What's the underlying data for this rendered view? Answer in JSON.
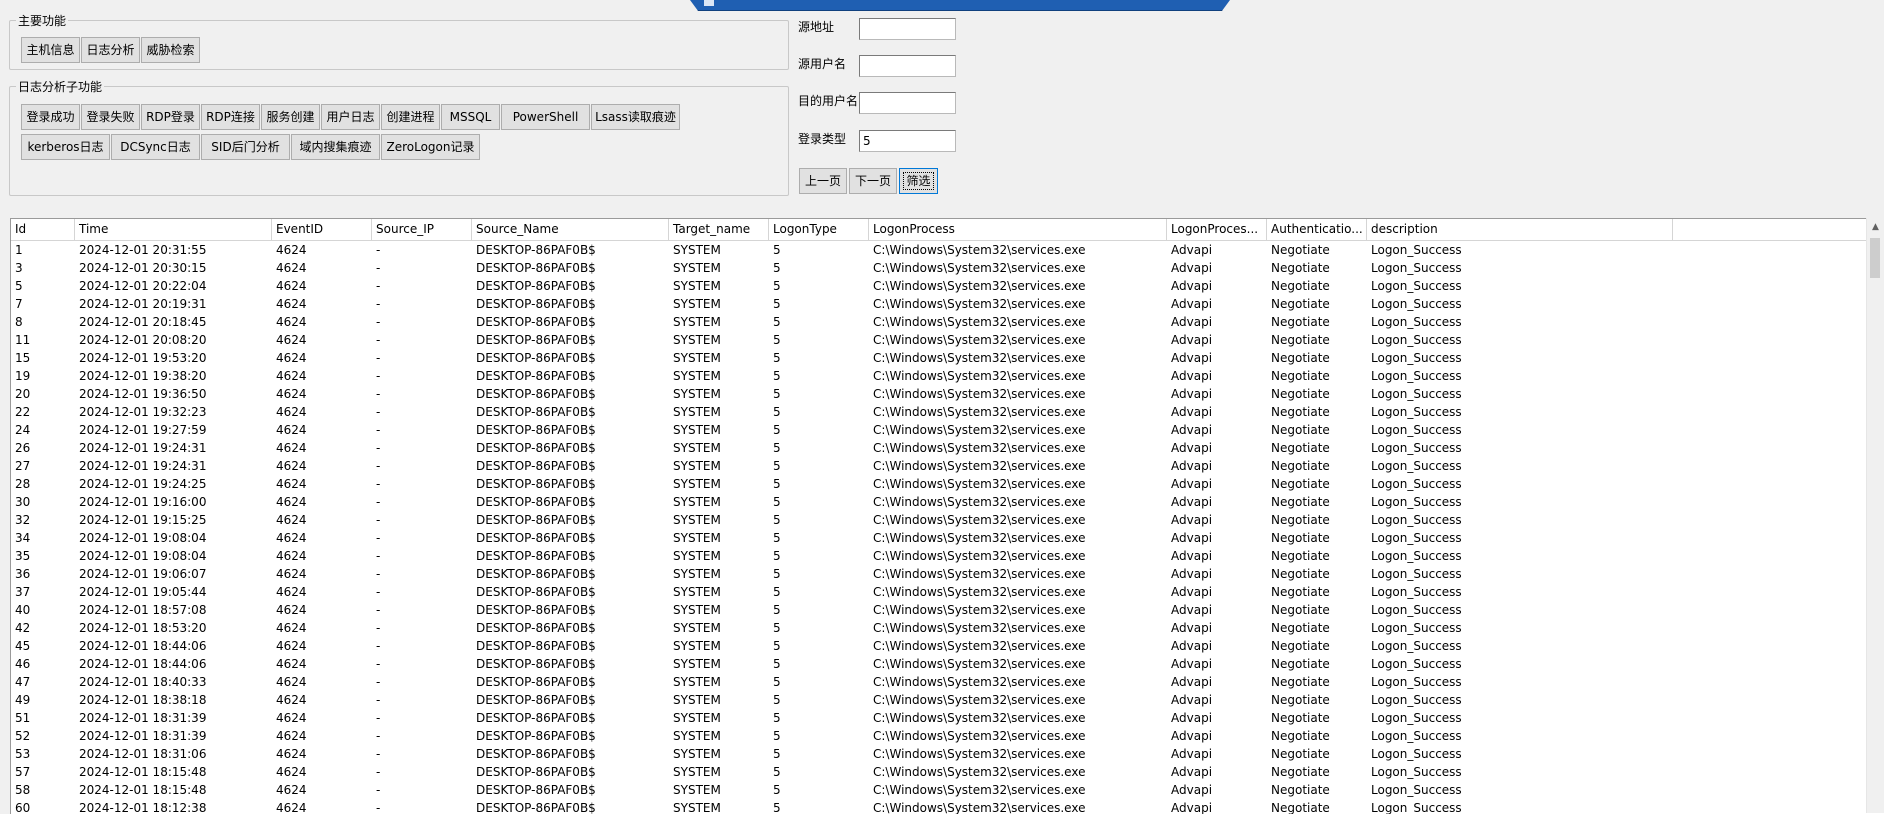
{
  "main_group": {
    "title": "主要功能",
    "buttons": [
      "主机信息",
      "日志分析",
      "威胁检索"
    ]
  },
  "sub_group": {
    "title": "日志分析子功能",
    "row1": [
      "登录成功",
      "登录失败",
      "RDP登录",
      "RDP连接",
      "服务创建",
      "用户日志",
      "创建进程",
      "MSSQL",
      "PowerShell",
      "Lsass读取痕迹"
    ],
    "row2": [
      "kerberos日志",
      "DCSync日志",
      "SID后门分析",
      "域内搜集痕迹",
      "ZeroLogon记录"
    ]
  },
  "filters": {
    "source_address_label": "源地址",
    "source_address_value": "",
    "source_user_label": "源用户名",
    "source_user_value": "",
    "target_user_label": "目的用户名",
    "target_user_value": "",
    "logon_type_label": "登录类型",
    "logon_type_value": "5",
    "prev_label": "上一页",
    "next_label": "下一页",
    "filter_label": "筛选"
  },
  "table": {
    "columns": [
      "Id",
      "Time",
      "EventID",
      "Source_IP",
      "Source_Name",
      "Target_name",
      "LogonType",
      "LogonProcess",
      "LogonProces...",
      "Authenticatio...",
      "description"
    ],
    "rows": [
      [
        "1",
        "2024-12-01 20:31:55"
      ],
      [
        "3",
        "2024-12-01 20:30:15"
      ],
      [
        "5",
        "2024-12-01 20:22:04"
      ],
      [
        "7",
        "2024-12-01 20:19:31"
      ],
      [
        "8",
        "2024-12-01 20:18:45"
      ],
      [
        "11",
        "2024-12-01 20:08:20"
      ],
      [
        "15",
        "2024-12-01 19:53:20"
      ],
      [
        "19",
        "2024-12-01 19:38:20"
      ],
      [
        "20",
        "2024-12-01 19:36:50"
      ],
      [
        "22",
        "2024-12-01 19:32:23"
      ],
      [
        "24",
        "2024-12-01 19:27:59"
      ],
      [
        "26",
        "2024-12-01 19:24:31"
      ],
      [
        "27",
        "2024-12-01 19:24:31"
      ],
      [
        "28",
        "2024-12-01 19:24:25"
      ],
      [
        "30",
        "2024-12-01 19:16:00"
      ],
      [
        "32",
        "2024-12-01 19:15:25"
      ],
      [
        "34",
        "2024-12-01 19:08:04"
      ],
      [
        "35",
        "2024-12-01 19:08:04"
      ],
      [
        "36",
        "2024-12-01 19:06:07"
      ],
      [
        "37",
        "2024-12-01 19:05:44"
      ],
      [
        "40",
        "2024-12-01 18:57:08"
      ],
      [
        "42",
        "2024-12-01 18:53:20"
      ],
      [
        "45",
        "2024-12-01 18:44:06"
      ],
      [
        "46",
        "2024-12-01 18:44:06"
      ],
      [
        "47",
        "2024-12-01 18:40:33"
      ],
      [
        "49",
        "2024-12-01 18:38:18"
      ],
      [
        "51",
        "2024-12-01 18:31:39"
      ],
      [
        "52",
        "2024-12-01 18:31:39"
      ],
      [
        "53",
        "2024-12-01 18:31:06"
      ],
      [
        "57",
        "2024-12-01 18:15:48"
      ],
      [
        "58",
        "2024-12-01 18:15:48"
      ],
      [
        "60",
        "2024-12-01 18:12:38"
      ]
    ],
    "common": {
      "event_id": "4624",
      "source_ip": "-",
      "source_name": "DESKTOP-86PAF0B$",
      "target_name": "SYSTEM",
      "logon_type": "5",
      "logon_process": "C:\\Windows\\System32\\services.exe",
      "logon_process_name": "Advapi",
      "authentication": "Negotiate",
      "description": "Logon_Success"
    }
  }
}
